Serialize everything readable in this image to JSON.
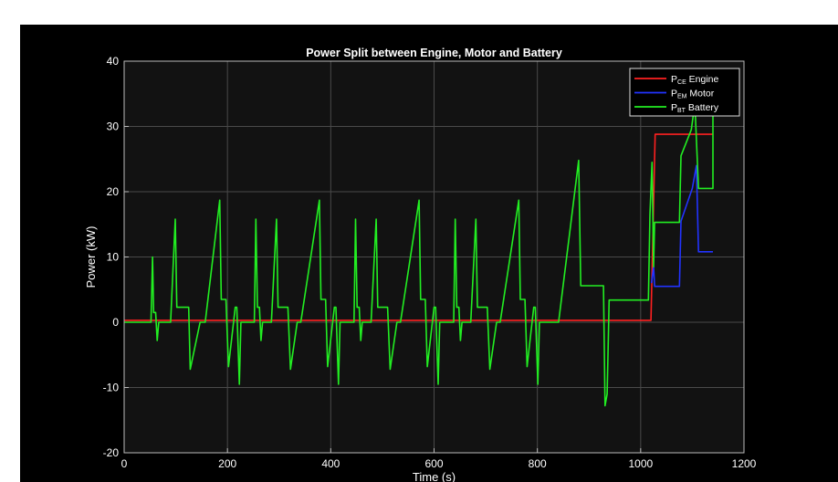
{
  "chart_data": {
    "type": "line",
    "title": "Power Split between Engine, Motor and Battery",
    "xlabel": "Time (s)",
    "ylabel": "Power (kW)",
    "xlim": [
      0,
      1200
    ],
    "ylim": [
      -20,
      40
    ],
    "xticks": [
      0,
      200,
      400,
      600,
      800,
      1000,
      1200
    ],
    "yticks": [
      -20,
      -10,
      0,
      10,
      20,
      30,
      40
    ],
    "grid": true,
    "legend_position": "top-right",
    "background": "#121212",
    "legend": [
      {
        "main": "P",
        "sub": "CE",
        "rest": " Engine",
        "color": "#ff2020"
      },
      {
        "main": "P",
        "sub": "EM",
        "rest": " Motor",
        "color": "#2233ff"
      },
      {
        "main": "P",
        "sub": "BT",
        "rest": " Battery",
        "color": "#22ee22"
      }
    ],
    "series": [
      {
        "color": "#ff2020",
        "x": [
          0,
          1020,
          1028,
          1140
        ],
        "y": [
          0.3,
          0.3,
          28.8,
          28.8
        ]
      },
      {
        "color": "#2233ff",
        "x": [
          1021,
          1025,
          1027,
          1075,
          1078,
          1100,
          1108,
          1112,
          1140
        ],
        "y": [
          6,
          8.5,
          5.5,
          5.5,
          15.5,
          20.5,
          24,
          10.8,
          10.8
        ]
      },
      {
        "color": "#22ee22",
        "x": [
          0,
          52,
          55,
          57,
          61,
          64,
          67,
          70,
          90,
          99,
          102,
          125,
          128,
          147,
          157,
          185,
          188,
          197,
          202,
          215,
          218,
          223,
          226,
          242,
          252,
          255,
          258,
          262,
          265,
          268,
          285,
          295,
          298,
          317,
          322,
          335,
          342,
          378,
          381,
          390,
          394,
          407,
          410,
          415,
          418,
          435,
          445,
          448,
          451,
          455,
          458,
          461,
          478,
          488,
          491,
          510,
          515,
          528,
          535,
          571,
          574,
          583,
          587,
          600,
          603,
          608,
          611,
          628,
          638,
          641,
          644,
          648,
          651,
          654,
          671,
          681,
          684,
          703,
          708,
          721,
          728,
          764,
          767,
          776,
          780,
          793,
          796,
          801,
          804,
          821,
          841,
          880,
          884,
          928,
          931,
          935,
          939,
          1015,
          1018,
          1022,
          1025,
          1027,
          1040,
          1075,
          1078,
          1098,
          1105,
          1112,
          1140,
          1140
        ],
        "y": [
          0,
          0,
          10,
          1.5,
          1.5,
          -2.8,
          0,
          0,
          0,
          15.8,
          2.3,
          2.3,
          -7.2,
          0,
          0,
          18.7,
          3.5,
          3.5,
          -6.8,
          2.3,
          2.3,
          -9.5,
          0,
          0,
          0,
          15.8,
          2.3,
          2.3,
          -2.8,
          0,
          0,
          15.8,
          2.3,
          2.3,
          -7.2,
          0,
          0,
          18.7,
          3.5,
          3.5,
          -6.8,
          2.3,
          2.3,
          -9.5,
          0,
          0,
          0,
          15.8,
          2.3,
          2.3,
          -2.8,
          0,
          0,
          15.8,
          2.3,
          2.3,
          -7.2,
          0,
          0,
          18.7,
          3.5,
          3.5,
          -6.8,
          2.3,
          2.3,
          -9.5,
          0,
          0,
          0,
          15.8,
          2.3,
          2.3,
          -2.8,
          0,
          0,
          15.8,
          2.3,
          2.3,
          -7.2,
          0,
          0,
          18.7,
          3.5,
          3.5,
          -6.8,
          2.3,
          2.3,
          -9.5,
          0,
          0,
          0,
          24.8,
          5.6,
          5.6,
          -12.8,
          -11,
          3.4,
          3.4,
          16.5,
          24.5,
          8.5,
          15.3,
          15.3,
          15.3,
          25.5,
          29.5,
          33.5,
          20.5,
          20.5,
          34
        ]
      }
    ]
  }
}
